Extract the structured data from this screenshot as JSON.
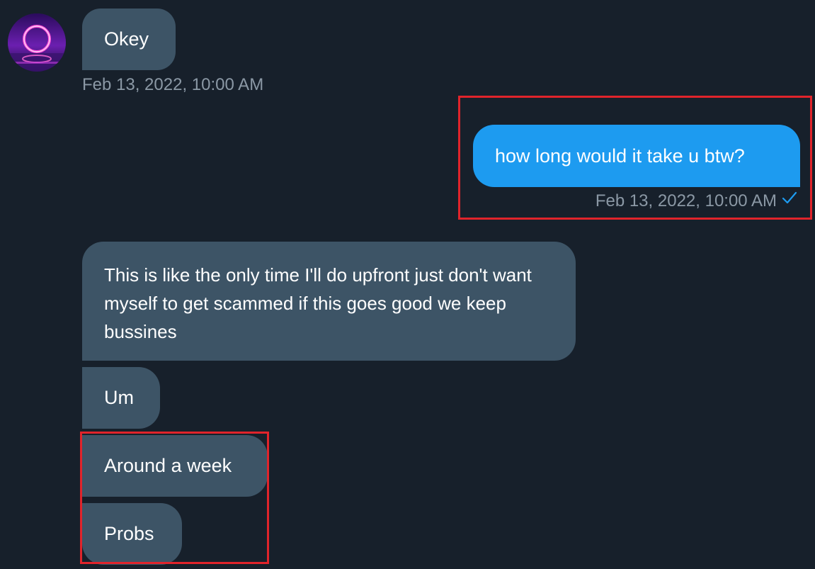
{
  "conversation": {
    "messages": [
      {
        "direction": "incoming",
        "text": "Okey"
      },
      {
        "direction": "outgoing",
        "text": "how long would it take u btw?"
      },
      {
        "direction": "incoming",
        "text": "This is like the only time I'll do upfront just don't want myself to get scammed if this goes good we keep bussines"
      },
      {
        "direction": "incoming",
        "text": "Um"
      },
      {
        "direction": "incoming",
        "text": "Around a week"
      },
      {
        "direction": "incoming",
        "text": "Probs"
      }
    ],
    "timestamps": {
      "incoming_first": "Feb 13, 2022, 10:00 AM",
      "outgoing": "Feb 13, 2022, 10:00 AM"
    }
  },
  "icons": {
    "avatar": "user-avatar-neon-ring",
    "sent_status": "check-icon"
  },
  "colors": {
    "background": "#17202b",
    "incoming_bubble": "#3d5466",
    "outgoing_bubble": "#1d9bf0",
    "timestamp": "#8b98a5",
    "highlight": "#e0242b"
  }
}
